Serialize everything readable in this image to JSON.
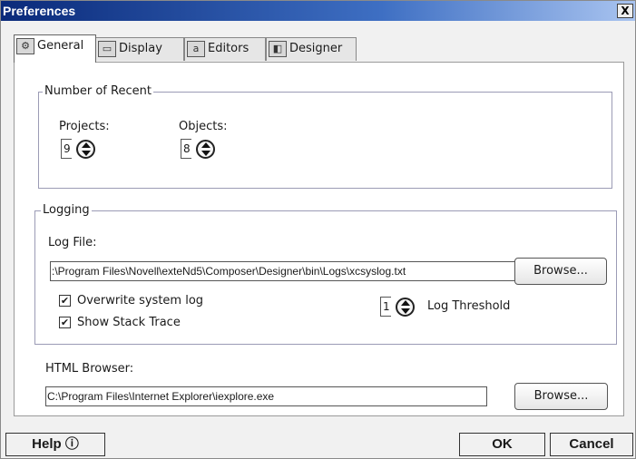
{
  "window": {
    "title": "Preferences",
    "close_glyph": "X"
  },
  "tabs": [
    {
      "label": "General",
      "icon": "general-icon",
      "glyph": "⚙",
      "active": true
    },
    {
      "label": "Display",
      "icon": "display-icon",
      "glyph": "▭",
      "active": false
    },
    {
      "label": "Editors",
      "icon": "editors-icon",
      "glyph": "a",
      "active": false
    },
    {
      "label": "Designer",
      "icon": "designer-icon",
      "glyph": "◧",
      "active": false
    }
  ],
  "recent": {
    "legend": "Number of Recent",
    "projects_label": "Projects:",
    "projects_value": "9",
    "objects_label": "Objects:",
    "objects_value": "8"
  },
  "logging": {
    "legend": "Logging",
    "log_file_label": "Log File:",
    "log_file_value": ":\\Program Files\\Novell\\exteNd5\\Composer\\Designer\\bin\\Logs\\xcsyslog.txt",
    "browse_label": "Browse...",
    "overwrite_label": "Overwrite system log",
    "overwrite_checked": true,
    "stack_trace_label": "Show Stack Trace",
    "stack_trace_checked": true,
    "threshold_value": "1",
    "threshold_label": "Log Threshold"
  },
  "html_browser": {
    "label": "HTML Browser:",
    "value": "C:\\Program Files\\Internet Explorer\\iexplore.exe",
    "browse_label": "Browse..."
  },
  "footer": {
    "help_label": "Help ⓘ",
    "ok_label": "OK",
    "cancel_label": "Cancel"
  },
  "colors": {
    "title_start": "#0a2a7a",
    "title_end": "#a9c4f0",
    "groupbox_border": "#9b9bb5"
  }
}
